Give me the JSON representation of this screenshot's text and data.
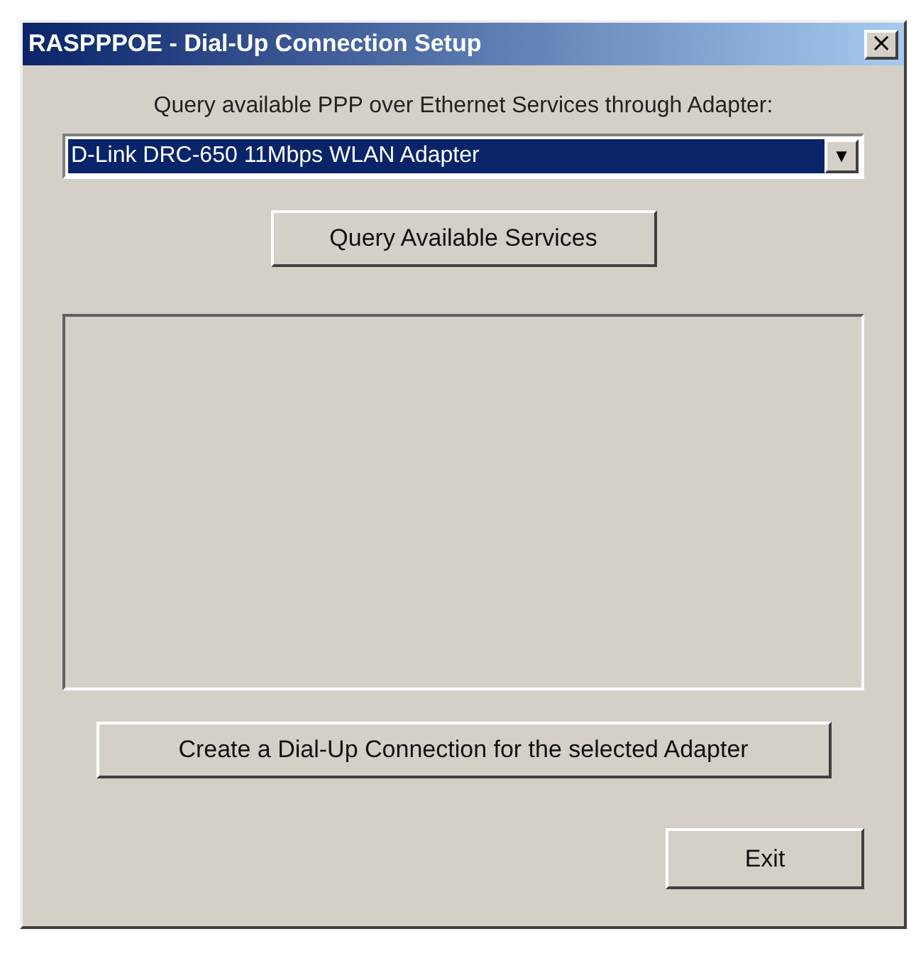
{
  "window": {
    "title": "RASPPPOE - Dial-Up Connection Setup",
    "close": "×"
  },
  "adapter_label": "Query available PPP over Ethernet Services through Adapter:",
  "adapter_dropdown": {
    "value": "D-Link DRC-650 11Mbps WLAN Adapter",
    "highlighted": true,
    "arrow": "▼"
  },
  "query_button": "Query Available Services",
  "create_button": "Create a Dial-Up Connection for the selected Adapter",
  "exit_button": "Exit"
}
